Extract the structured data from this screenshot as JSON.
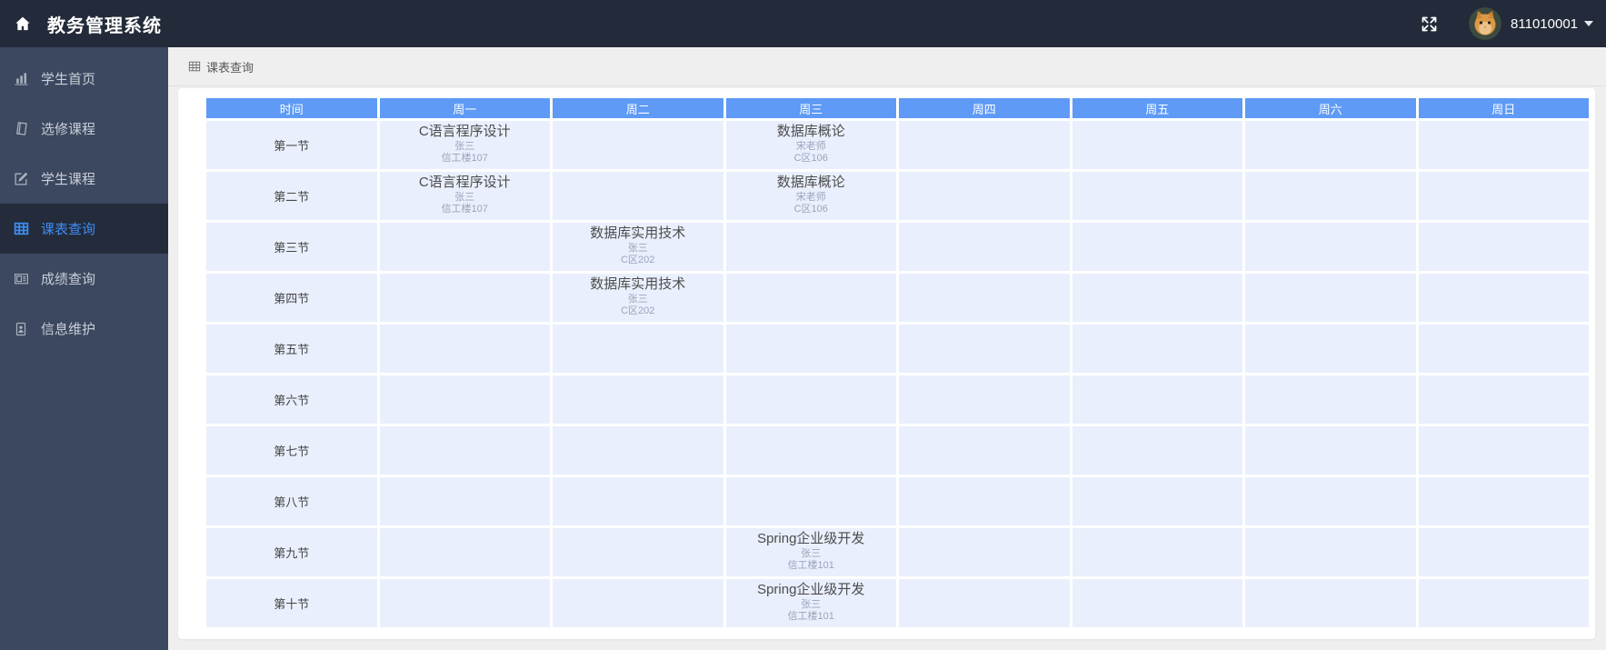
{
  "app": {
    "title": "教务管理系统",
    "user_id": "811010001"
  },
  "sidebar": {
    "items": [
      {
        "label": "学生首页",
        "icon": "bar-chart-icon",
        "active": false
      },
      {
        "label": "选修课程",
        "icon": "book-icon",
        "active": false
      },
      {
        "label": "学生课程",
        "icon": "edit-icon",
        "active": false
      },
      {
        "label": "课表查询",
        "icon": "table-icon",
        "active": true
      },
      {
        "label": "成绩查询",
        "icon": "news-icon",
        "active": false
      },
      {
        "label": "信息维护",
        "icon": "id-card-icon",
        "active": false
      }
    ]
  },
  "breadcrumb": {
    "icon": "table-icon",
    "label": "课表查询"
  },
  "timetable": {
    "columns": [
      "时间",
      "周一",
      "周二",
      "周三",
      "周四",
      "周五",
      "周六",
      "周日"
    ],
    "rows": [
      {
        "time": "第一节",
        "cells": [
          {
            "course": "C语言程序设计",
            "teacher": "张三",
            "room": "信工楼107"
          },
          null,
          {
            "course": "数据库概论",
            "teacher": "宋老师",
            "room": "C区106"
          },
          null,
          null,
          null,
          null
        ]
      },
      {
        "time": "第二节",
        "cells": [
          {
            "course": "C语言程序设计",
            "teacher": "张三",
            "room": "信工楼107"
          },
          null,
          {
            "course": "数据库概论",
            "teacher": "宋老师",
            "room": "C区106"
          },
          null,
          null,
          null,
          null
        ]
      },
      {
        "time": "第三节",
        "cells": [
          null,
          {
            "course": "数据库实用技术",
            "teacher": "张三",
            "room": "C区202"
          },
          null,
          null,
          null,
          null,
          null
        ]
      },
      {
        "time": "第四节",
        "cells": [
          null,
          {
            "course": "数据库实用技术",
            "teacher": "张三",
            "room": "C区202"
          },
          null,
          null,
          null,
          null,
          null
        ]
      },
      {
        "time": "第五节",
        "cells": [
          null,
          null,
          null,
          null,
          null,
          null,
          null
        ]
      },
      {
        "time": "第六节",
        "cells": [
          null,
          null,
          null,
          null,
          null,
          null,
          null
        ]
      },
      {
        "time": "第七节",
        "cells": [
          null,
          null,
          null,
          null,
          null,
          null,
          null
        ]
      },
      {
        "time": "第八节",
        "cells": [
          null,
          null,
          null,
          null,
          null,
          null,
          null
        ]
      },
      {
        "time": "第九节",
        "cells": [
          null,
          null,
          {
            "course": "Spring企业级开发",
            "teacher": "张三",
            "room": "信工楼101"
          },
          null,
          null,
          null,
          null
        ]
      },
      {
        "time": "第十节",
        "cells": [
          null,
          null,
          {
            "course": "Spring企业级开发",
            "teacher": "张三",
            "room": "信工楼101"
          },
          null,
          null,
          null,
          null
        ]
      }
    ]
  },
  "colors": {
    "navbar_bg": "#232a39",
    "sidebar_bg": "#3c4860",
    "active_bg": "#242b3a",
    "accent_blue": "#3e8df6",
    "table_header_bg": "#5e9af6",
    "cell_bg": "#e9effc",
    "content_bg": "#efefef",
    "course_text": "#4c4c4c",
    "muted_text": "#9aa4bc"
  }
}
